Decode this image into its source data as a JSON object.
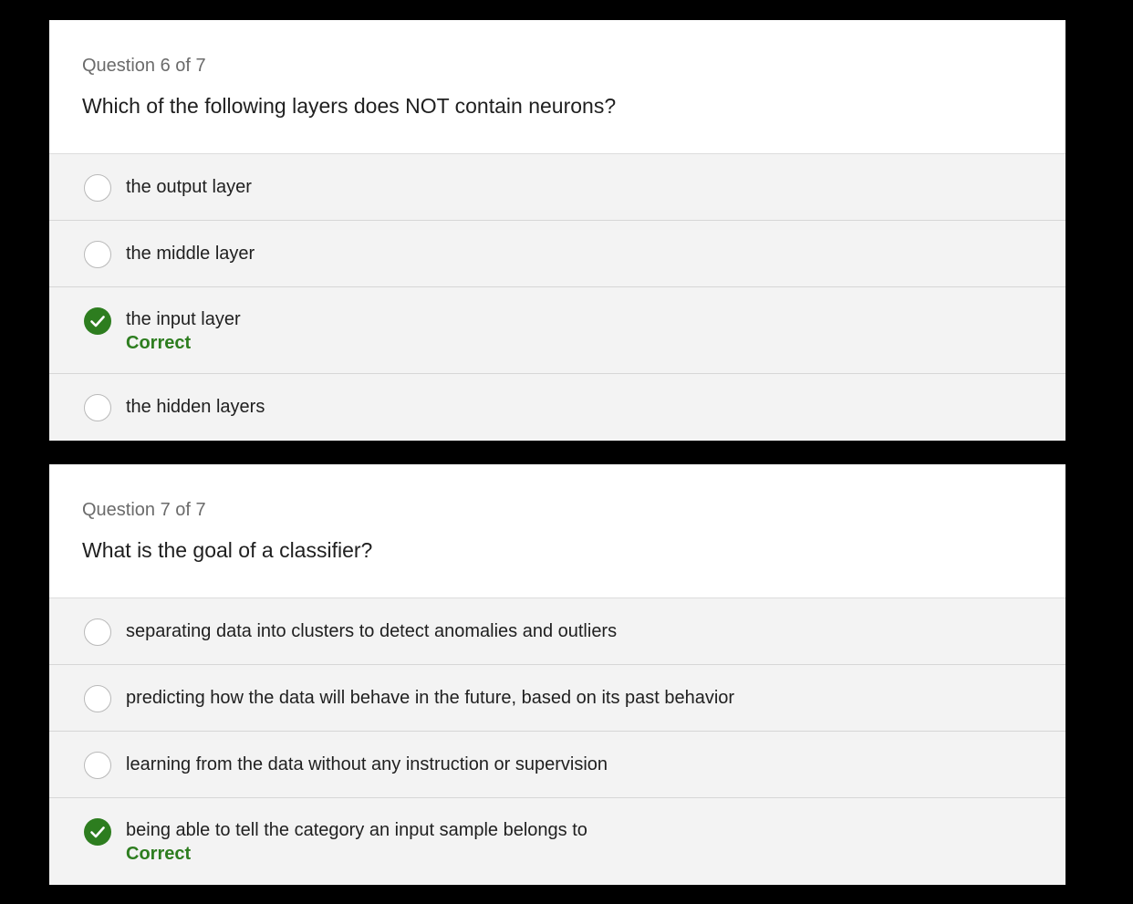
{
  "questions": [
    {
      "counter": "Question 6 of 7",
      "prompt": "Which of the following layers does NOT contain neurons?",
      "options": [
        {
          "label": "the output layer",
          "state": "unselected"
        },
        {
          "label": "the middle layer",
          "state": "unselected"
        },
        {
          "label": "the input layer",
          "state": "correct",
          "feedback": "Correct"
        },
        {
          "label": "the hidden layers",
          "state": "unselected"
        }
      ]
    },
    {
      "counter": "Question 7 of 7",
      "prompt": "What is the goal of a classifier?",
      "options": [
        {
          "label": "separating data into clusters to detect anomalies and outliers",
          "state": "unselected"
        },
        {
          "label": "predicting how the data will behave in the future, based on its past behavior",
          "state": "unselected"
        },
        {
          "label": "learning from the data without any instruction or supervision",
          "state": "unselected"
        },
        {
          "label": "being able to tell the category an input sample belongs to",
          "state": "correct",
          "feedback": "Correct"
        }
      ]
    }
  ],
  "colors": {
    "correct": "#2d7d1f",
    "option_bg": "#f3f3f3",
    "page_bg": "#000000"
  },
  "icons": {
    "radio": "radio-circle-icon",
    "correct": "checkmark-circle-icon"
  }
}
